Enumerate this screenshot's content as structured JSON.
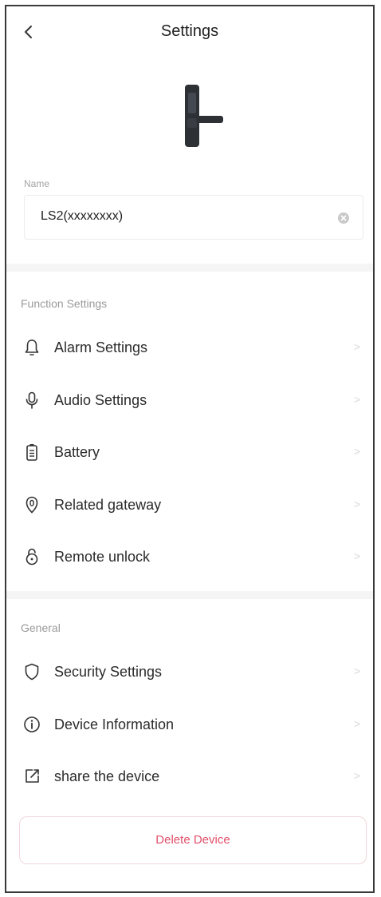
{
  "header": {
    "title": "Settings",
    "back_icon": "chevron-left-icon"
  },
  "device": {
    "image": "smart-lock-image"
  },
  "name": {
    "label": "Name",
    "value": "LS2(xxxxxxxx)",
    "clear_icon": "clear-icon"
  },
  "function_settings": {
    "label": "Function Settings",
    "items": [
      {
        "label": "Alarm Settings",
        "icon": "bell-icon"
      },
      {
        "label": "Audio Settings",
        "icon": "microphone-icon"
      },
      {
        "label": "Battery",
        "icon": "battery-icon"
      },
      {
        "label": "Related gateway",
        "icon": "location-pin-icon"
      },
      {
        "label": "Remote unlock",
        "icon": "unlock-icon"
      }
    ]
  },
  "general": {
    "label": "General",
    "items": [
      {
        "label": "Security Settings",
        "icon": "shield-icon"
      },
      {
        "label": "Device Information",
        "icon": "info-icon"
      },
      {
        "label": "share the device",
        "icon": "share-icon"
      }
    ]
  },
  "chevron": ">",
  "delete_button": {
    "label": "Delete Device"
  },
  "colors": {
    "accent_delete": "#e0506a",
    "divider": "#f5f5f6"
  }
}
